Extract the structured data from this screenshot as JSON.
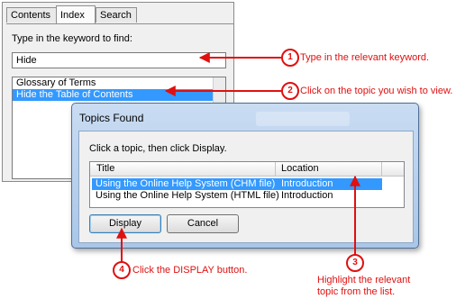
{
  "help": {
    "tabs": [
      "Contents",
      "Index",
      "Search"
    ],
    "prompt": "Type in the keyword to find:",
    "keyword_value": "Hide",
    "topics": [
      "Glossary of Terms",
      "Hide the Table of Contents"
    ]
  },
  "dialog": {
    "title": "Topics Found",
    "instruction": "Click a topic, then click Display.",
    "columns": [
      "Title",
      "Location"
    ],
    "rows": [
      {
        "title": "Using the Online Help System (CHM file)",
        "location": "Introduction"
      },
      {
        "title": "Using the Online Help System (HTML file)",
        "location": "Introduction"
      }
    ],
    "display_label": "Display",
    "cancel_label": "Cancel"
  },
  "callouts": [
    {
      "num": "1",
      "text": "Type in the relevant keyword."
    },
    {
      "num": "2",
      "text": "Click on the topic you wish to view."
    },
    {
      "num": "3",
      "line1": "Highlight the relevant",
      "line2": "topic from the list."
    },
    {
      "num": "4",
      "text": "Click the DISPLAY button."
    }
  ],
  "colors": {
    "accent_red": "#e01010",
    "selection_blue": "#3399ff"
  }
}
